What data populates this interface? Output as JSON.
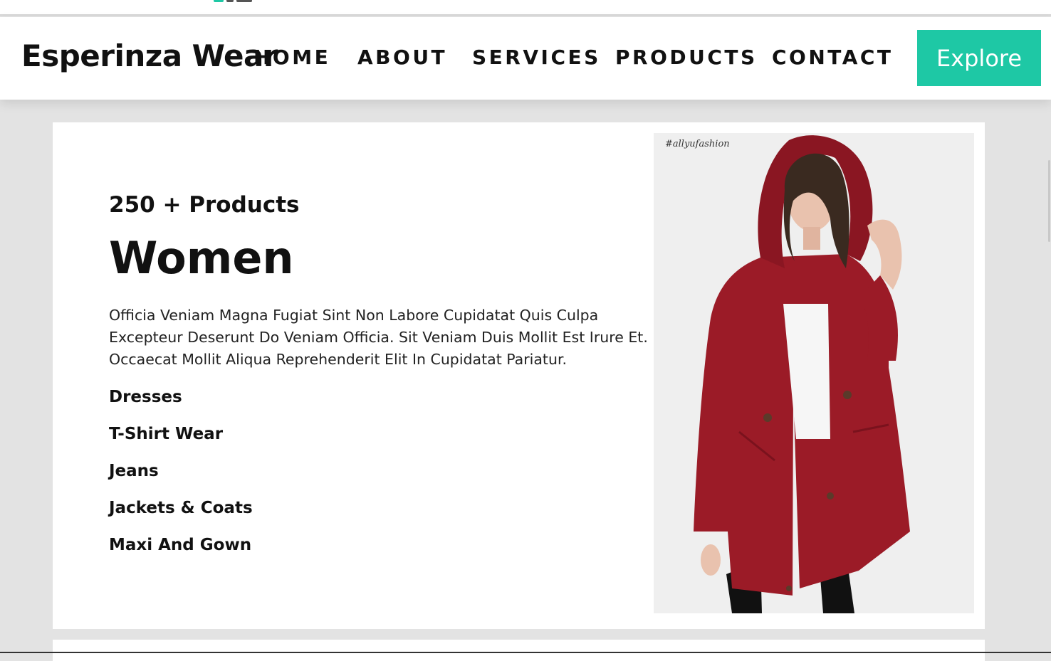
{
  "brand": "Esperinza Wear",
  "nav": {
    "home": "HOME",
    "about": "ABOUT",
    "services": "SERVICES",
    "products": "PRODUCTS",
    "contact": "CONTACT"
  },
  "cta": {
    "label": "Explore",
    "color": "#1ec8a5"
  },
  "section": {
    "count": "250 + Products",
    "title": "Women",
    "description": "Officia Veniam Magna Fugiat Sint Non Labore Cupidatat Quis Culpa Excepteur Deserunt Do Veniam Officia. Sit Veniam Duis Mollit Est Irure Et. Occaecat Mollit Aliqua Reprehenderit Elit In Cupidatat Pariatur.",
    "categories": [
      "Dresses",
      "T-Shirt Wear",
      "Jeans",
      "Jackets & Coats",
      "Maxi And Gown"
    ],
    "image": {
      "watermark": "#allyufashion",
      "subject": "woman-in-red-hooded-jacket",
      "jacket_color": "#9b1b27"
    }
  }
}
